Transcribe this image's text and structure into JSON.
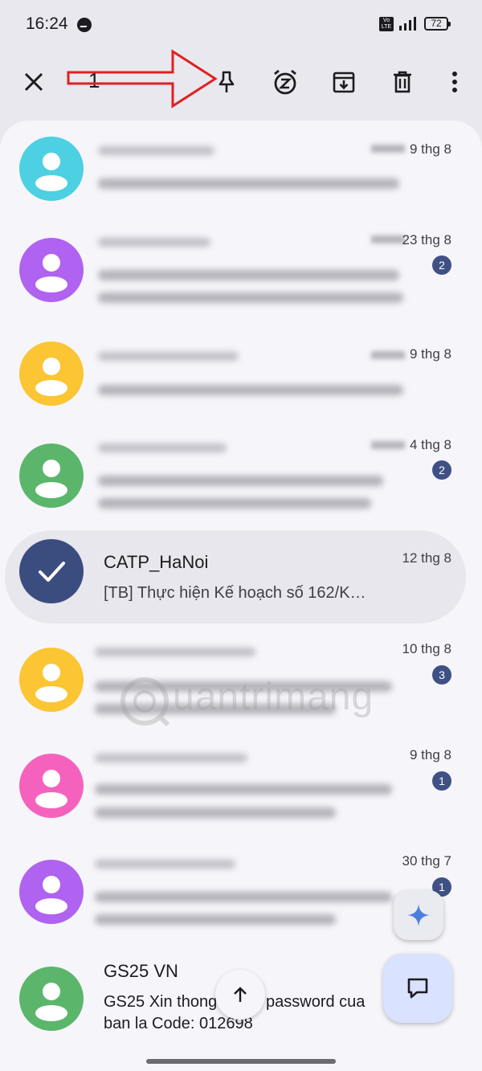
{
  "status_bar": {
    "time": "16:24",
    "volte": "Vo LTE",
    "battery": "72"
  },
  "action_bar": {
    "selected_count": "1",
    "icons": [
      "close-icon",
      "pin-icon",
      "snooze-icon",
      "archive-icon",
      "delete-icon",
      "more-vert-icon"
    ]
  },
  "conversations": [
    {
      "date": "9 thg 8",
      "avatar_color": "#4dd0e1"
    },
    {
      "date": "23 thg 8",
      "badge": "2",
      "avatar_color": "#b062f0"
    },
    {
      "date": "9 thg 8",
      "avatar_color": "#fbc533"
    },
    {
      "date": "4 thg 8",
      "badge": "2",
      "avatar_color": "#5bb66b"
    },
    {
      "name": "CATP_HaNoi",
      "date": "12 thg 8",
      "preview": "[TB] Thực hiện Kế hoạch số 162/K…",
      "selected": true
    },
    {
      "date": "10 thg 8",
      "badge": "3",
      "avatar_color": "#fbc533"
    },
    {
      "date": "9 thg 8",
      "badge": "1",
      "avatar_color": "#f562bd"
    },
    {
      "date": "30 thg 7",
      "badge": "1",
      "avatar_color": "#b062f0"
    },
    {
      "name": "GS25 VN",
      "preview_line1": "GS25 Xin thong",
      "preview_line1b": "password cua",
      "preview_line2": "ban la Code: 012698",
      "avatar_color": "#5bb66b"
    }
  ],
  "watermark": "uantrimang",
  "colors": {
    "badge": "#3f5184",
    "selected_avatar": "#3b4d7f",
    "annotation_arrow": "#e02020"
  }
}
